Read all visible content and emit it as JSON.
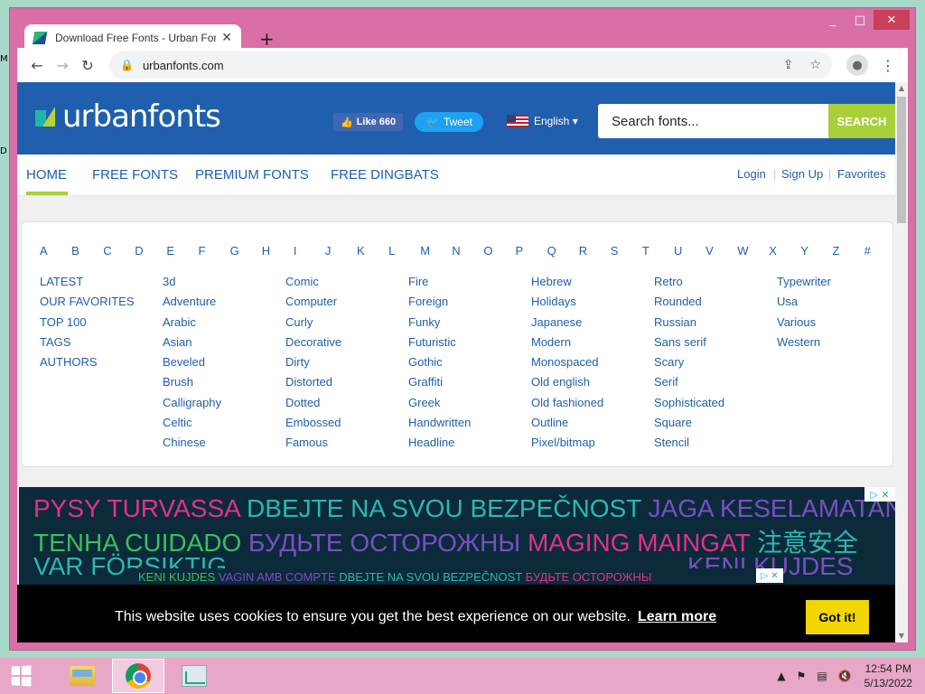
{
  "window": {
    "min": "_",
    "max": "□",
    "close": "✕"
  },
  "tab": {
    "title": "Download Free Fonts - Urban Fonts",
    "close": "✕",
    "new": "+"
  },
  "toolbar": {
    "back": "←",
    "forward": "→",
    "reload": "↻",
    "lock": "🔒",
    "url": "urbanfonts.com",
    "share": "⇪",
    "star": "☆",
    "menu": "⋮"
  },
  "site": {
    "logo": "urbanfonts",
    "fb_like": "Like 660",
    "tweet": "Tweet",
    "language": "English ▾",
    "search_placeholder": "Search fonts...",
    "search_button": "SEARCH"
  },
  "nav": {
    "items": [
      "HOME",
      "FREE FONTS",
      "PREMIUM FONTS",
      "FREE DINGBATS"
    ],
    "right": [
      "Login",
      "Sign Up",
      "Favorites"
    ]
  },
  "alphabet": [
    "A",
    "B",
    "C",
    "D",
    "E",
    "F",
    "G",
    "H",
    "I",
    "J",
    "K",
    "L",
    "M",
    "N",
    "O",
    "P",
    "Q",
    "R",
    "S",
    "T",
    "U",
    "V",
    "W",
    "X",
    "Y",
    "Z",
    "#"
  ],
  "columns": [
    [
      "LATEST",
      "OUR FAVORITES",
      "TOP 100",
      "TAGS",
      "AUTHORS"
    ],
    [
      "3d",
      "Adventure",
      "Arabic",
      "Asian",
      "Beveled",
      "Brush",
      "Calligraphy",
      "Celtic",
      "Chinese"
    ],
    [
      "Comic",
      "Computer",
      "Curly",
      "Decorative",
      "Dirty",
      "Distorted",
      "Dotted",
      "Embossed",
      "Famous"
    ],
    [
      "Fire",
      "Foreign",
      "Funky",
      "Futuristic",
      "Gothic",
      "Graffiti",
      "Greek",
      "Handwritten",
      "Headline"
    ],
    [
      "Hebrew",
      "Holidays",
      "Japanese",
      "Modern",
      "Monospaced",
      "Old english",
      "Old fashioned",
      "Outline",
      "Pixel/bitmap"
    ],
    [
      "Retro",
      "Rounded",
      "Russian",
      "Sans serif",
      "Scary",
      "Serif",
      "Sophisticated",
      "Square",
      "Stencil"
    ],
    [
      "Typewriter",
      "Usa",
      "Various",
      "Western"
    ]
  ],
  "ad": {
    "line1": [
      {
        "text": "PYSY TURVASSA ",
        "color": "#e0338a"
      },
      {
        "text": "DBEJTE NA SVOU BEZPEČNOST ",
        "color": "#2bb8b0"
      },
      {
        "text": "JAGA KESELAMATAN",
        "color": "#7a4fc4"
      }
    ],
    "line2": [
      {
        "text": "TENHA CUIDADO ",
        "color": "#3cbf5a"
      },
      {
        "text": "БУДЬТЕ ОСТОРОЖНЫ ",
        "color": "#7a4fc4"
      },
      {
        "text": "MAGING MAINGAT ",
        "color": "#e0338a"
      },
      {
        "text": "注意安全",
        "color": "#2bb8b0"
      }
    ],
    "line3": [
      {
        "text": "VAR FÖRSIKTIG",
        "color": "#2bb8b0"
      }
    ],
    "line3_right": [
      {
        "text": "KENI KUJDES",
        "color": "#7a4fc4"
      }
    ],
    "ad_marks": "▷ ✕",
    "strip": [
      {
        "text": "KENI KUJDES ",
        "color": "#3cbf5a"
      },
      {
        "text": "VAGIN AMB COMPTE ",
        "color": "#7a4fc4"
      },
      {
        "text": "DBEJTE NA SVOU BEZPEČNOST ",
        "color": "#2bb8b0"
      },
      {
        "text": "БУДЬТЕ ОСТОРОЖНЫ",
        "color": "#e0338a"
      }
    ]
  },
  "cookie": {
    "text": "This website uses cookies to ensure you get the best experience on our website.",
    "link": "Learn more",
    "button": "Got it!"
  },
  "taskbar": {
    "tray_up": "▲",
    "time": "12:54 PM",
    "date": "5/13/2022"
  },
  "desktop_edge": [
    "M",
    "D"
  ]
}
